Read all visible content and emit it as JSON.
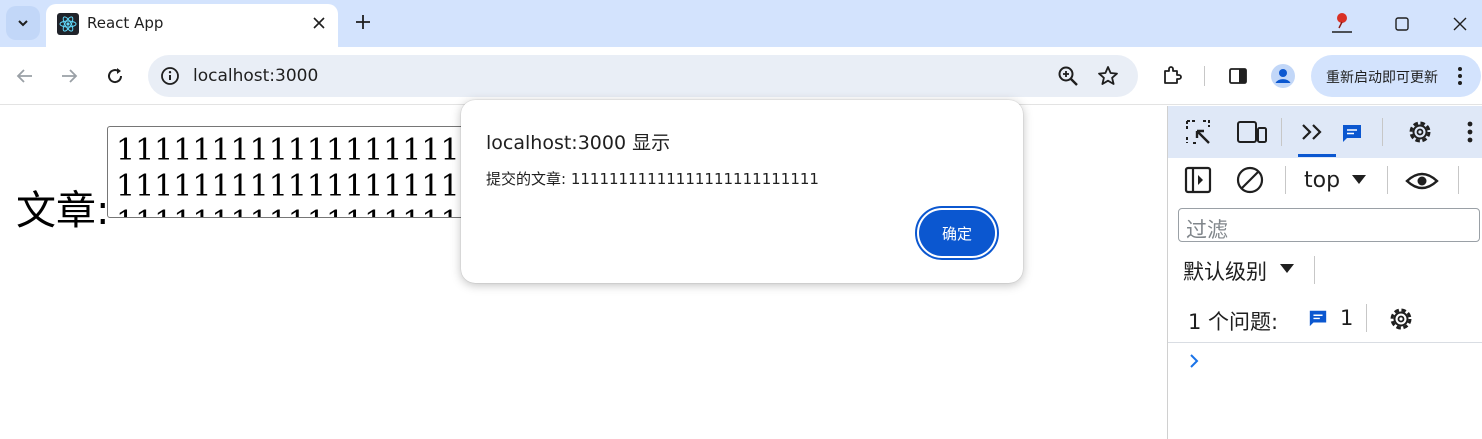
{
  "tab": {
    "title": "React App"
  },
  "omnibox": {
    "url": "localhost:3000"
  },
  "toolbar": {
    "update_label": "重新启动即可更新"
  },
  "page": {
    "article_label": "文章:",
    "article_value": "1111111111111111111111111111111111111111111111111111111111111111111111111111"
  },
  "alert": {
    "title": "localhost:3000 显示",
    "message": "提交的文章: 11111111111111111111111111",
    "ok_label": "确定"
  },
  "devtools": {
    "context": "top",
    "filter_placeholder": "过滤",
    "level_label": "默认级别",
    "issues_label": "1 个问题:",
    "issues_count": "1"
  },
  "colors": {
    "tabstrip_bg": "#d3e3fd",
    "omnibox_bg": "#e9eef6",
    "accent": "#0b57d0"
  },
  "icons": [
    "chevron-down-icon",
    "react-icon",
    "close-icon",
    "plus-icon",
    "minimize-icon",
    "maximize-icon",
    "back-arrow-icon",
    "forward-arrow-icon",
    "reload-icon",
    "info-icon",
    "zoom-icon",
    "star-icon",
    "extensions-icon",
    "side-panel-icon",
    "profile-icon",
    "kebab-icon",
    "inspect-icon",
    "device-icon",
    "console-icon",
    "messages-icon",
    "gear-icon",
    "sidebar-toggle-icon",
    "clear-icon",
    "eye-icon",
    "chevron-right-icon"
  ]
}
